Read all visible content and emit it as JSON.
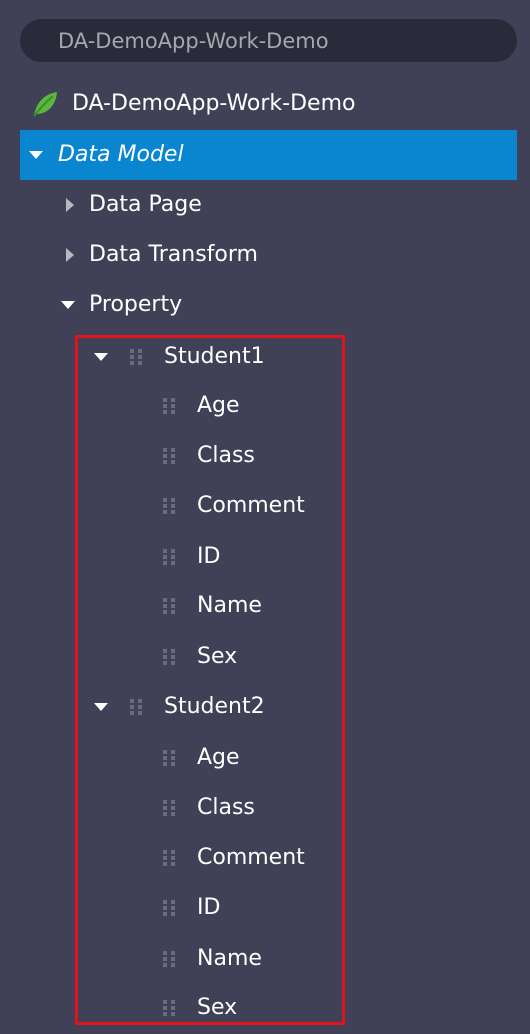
{
  "search": {
    "value": "DA-DemoApp-Work-Demo"
  },
  "tree": {
    "app_label": "DA-DemoApp-Work-Demo",
    "data_model": "Data Model",
    "data_page": "Data Page",
    "data_transform": "Data Transform",
    "property": "Property",
    "student1": {
      "label": "Student1",
      "fields": [
        "Age",
        "Class",
        "Comment",
        "ID",
        "Name",
        "Sex"
      ]
    },
    "student2": {
      "label": "Student2",
      "fields": [
        "Age",
        "Class",
        "Comment",
        "ID",
        "Name",
        "Sex"
      ]
    }
  },
  "colors": {
    "background": "#404057",
    "selected": "#0a86d0",
    "highlight": "#e0141c",
    "leaf_icon": "#5cb83c"
  }
}
